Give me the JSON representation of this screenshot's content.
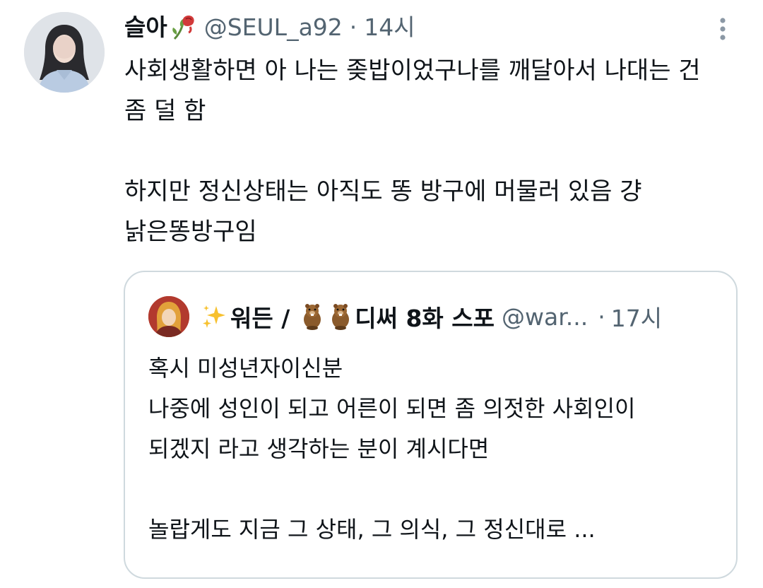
{
  "tweet": {
    "display_name": "슬아",
    "name_emoji": "wilted-rose-emoji",
    "handle": "@SEUL_a92",
    "separator": "·",
    "time": "14시",
    "lines": [
      "사회생활하면 아 나는 좆밥이었구나를 깨달아서 나대는 건",
      "좀 덜 함",
      "",
      "하지만 정신상태는 아직도 똥 방구에 머물러 있음 걍",
      "낡은똥방구임"
    ]
  },
  "quote": {
    "name_prefix": "워든 /",
    "name_suffix": "디써 8화 스포",
    "handle": "@war...",
    "separator": "·",
    "time": "17시",
    "name_emojis": [
      "sparkles-emoji",
      "beaver-emoji",
      "beaver-emoji"
    ],
    "lines": [
      "혹시 미성년자이신분",
      "나중에 성인이 되고 어른이 되면 좀 의젓한 사회인이",
      "되겠지 라고 생각하는 분이 계시다면",
      "",
      "놀랍게도 지금 그 상태, 그 의식, 그 정신대로 ..."
    ]
  },
  "colors": {
    "text": "#0f1419",
    "secondary": "#536471",
    "border": "#cfd9de"
  }
}
